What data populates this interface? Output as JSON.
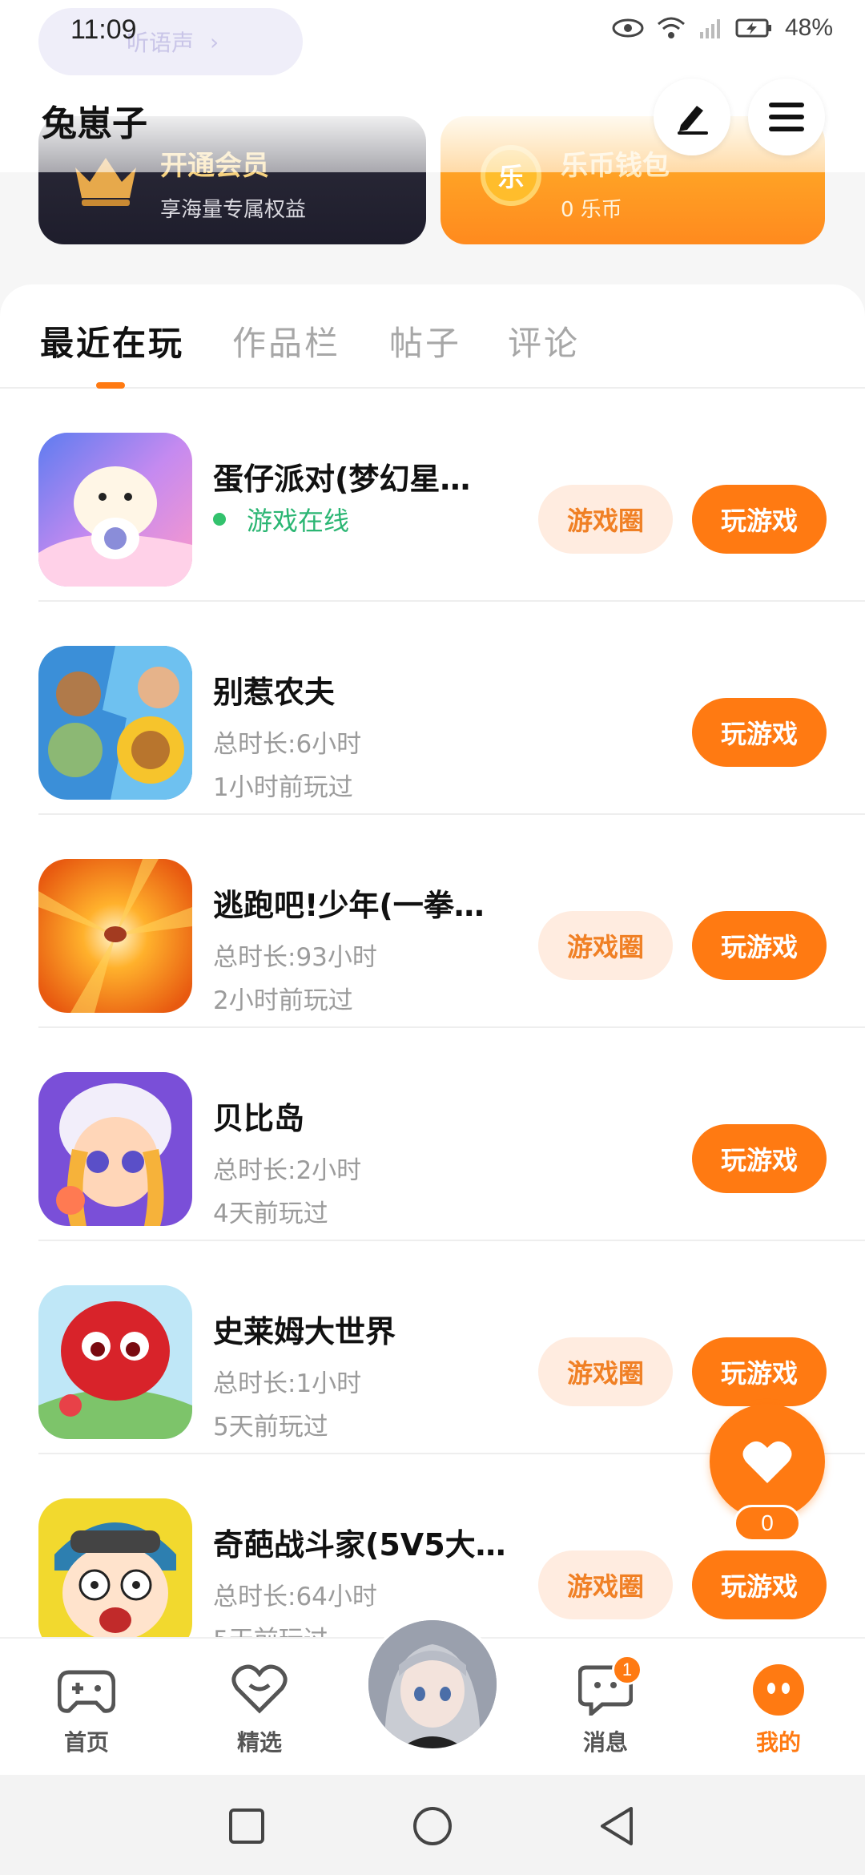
{
  "status_bar": {
    "time": "11:09",
    "battery": "48%"
  },
  "header": {
    "voice_label": "听语声",
    "username": "兔崽子",
    "vip": {
      "title": "开通会员",
      "subtitle": "享海量专属权益"
    },
    "wallet": {
      "title": "乐币钱包",
      "subtitle": "0 乐币",
      "coin_glyph": "乐"
    }
  },
  "tabs": [
    {
      "label": "最近在玩",
      "active": true
    },
    {
      "label": "作品栏",
      "active": false
    },
    {
      "label": "帖子",
      "active": false
    },
    {
      "label": "评论",
      "active": false
    }
  ],
  "games": [
    {
      "title": "蛋仔派对(梦幻星…",
      "status": "游戏在线",
      "circle_label": "游戏圈",
      "play_label": "玩游戏"
    },
    {
      "title": "别惹农夫",
      "duration": "总时长:6小时",
      "last_played": "1小时前玩过",
      "play_label": "玩游戏"
    },
    {
      "title": "逃跑吧!少年(一拳…",
      "duration": "总时长:93小时",
      "last_played": "2小时前玩过",
      "circle_label": "游戏圈",
      "play_label": "玩游戏"
    },
    {
      "title": "贝比岛",
      "duration": "总时长:2小时",
      "last_played": "4天前玩过",
      "play_label": "玩游戏"
    },
    {
      "title": "史莱姆大世界",
      "duration": "总时长:1小时",
      "last_played": "5天前玩过",
      "circle_label": "游戏圈",
      "play_label": "玩游戏"
    },
    {
      "title": "奇葩战斗家(5V5大…",
      "duration": "总时长:64小时",
      "last_played": "5天前玩过",
      "circle_label": "游戏圈",
      "play_label": "玩游戏"
    }
  ],
  "fab": {
    "count": "0"
  },
  "bottom_nav": {
    "home": "首页",
    "featured": "精选",
    "messages": "消息",
    "messages_badge": "1",
    "mine": "我的"
  },
  "colors": {
    "accent": "#ff7a12",
    "online": "#2bb673",
    "circle_btn_bg": "#ffece0"
  }
}
